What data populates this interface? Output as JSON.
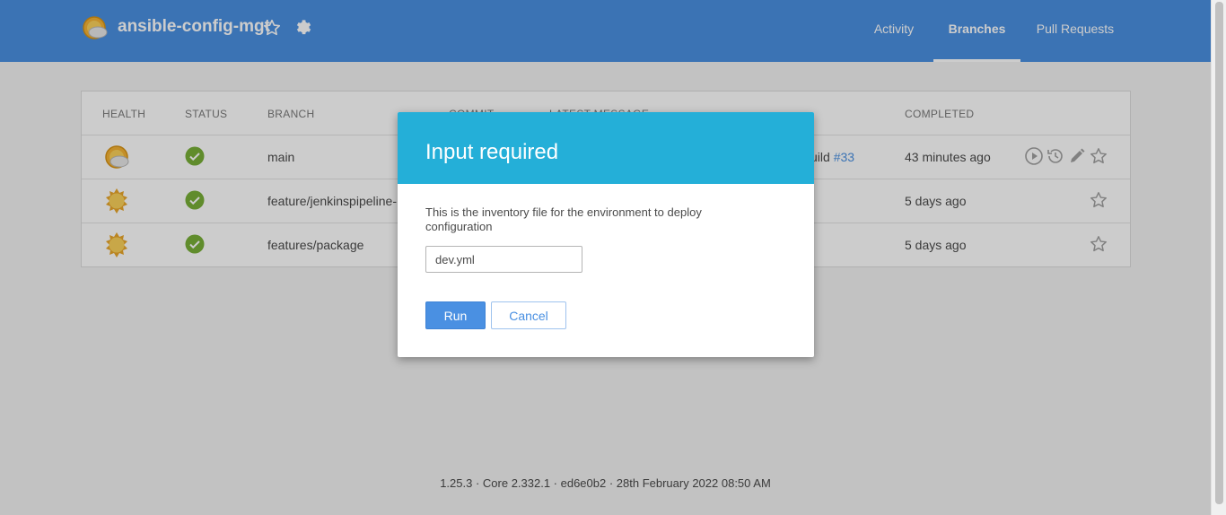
{
  "header": {
    "app_title": "ansible-config-mgt",
    "tabs": [
      {
        "label": "Activity"
      },
      {
        "label": "Branches"
      },
      {
        "label": "Pull Requests"
      }
    ]
  },
  "table": {
    "columns": [
      "HEALTH",
      "STATUS",
      "BRANCH",
      "COMMIT",
      "LATEST MESSAGE",
      "COMPLETED"
    ],
    "rows": [
      {
        "branch": "main",
        "message_tail": "uild",
        "message_link": "#33",
        "completed": "43 minutes ago"
      },
      {
        "branch": "feature/jenkinspipeline-",
        "completed": "5 days ago"
      },
      {
        "branch": "features/package",
        "completed": "5 days ago"
      }
    ]
  },
  "dialog": {
    "title": "Input required",
    "description": "This is the inventory file for the environment to deploy configuration",
    "input_value": "dev.yml",
    "run_label": "Run",
    "cancel_label": "Cancel"
  },
  "footer": {
    "text": "1.25.3 · Core 2.332.1 · ed6e0b2 · 28th February 2022 08:50 AM"
  },
  "colors": {
    "header": "#4a90e2",
    "dialog_header": "#24afd8",
    "success": "#78b037",
    "link": "#4a90e2"
  }
}
